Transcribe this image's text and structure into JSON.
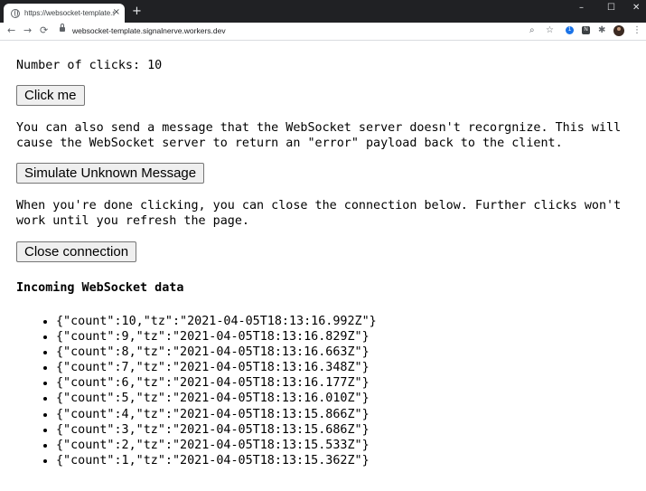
{
  "browser": {
    "tab_title": "https://websocket-template.signalnerve.workers.dev",
    "tab_close": "×",
    "new_tab": "+",
    "url": "websocket-template.signalnerve.workers.dev",
    "window_controls": {
      "minimize": "–",
      "maximize": "☐",
      "close": "✕"
    },
    "nav": {
      "back": "←",
      "forward": "→",
      "reload": "⟳"
    },
    "toolbar_icons": {
      "zoom": "⌕",
      "bookmark": "☆",
      "extensions": "✱",
      "menu": "⋮"
    },
    "extension_badges": [
      "1",
      "N"
    ]
  },
  "page": {
    "click_count_text": "Number of clicks: 10",
    "click_button": "Click me",
    "unknown_message_text_line1": "You can also send a message that the WebSocket server doesn't recorgnize. This will",
    "unknown_message_text_line2": "cause the WebSocket server to return an \"error\" payload back to the client.",
    "simulate_button": "Simulate Unknown Message",
    "close_text_line1": "When you're done clicking, you can close the connection below. Further clicks won't",
    "close_text_line2": "work until you refresh the page.",
    "close_button": "Close connection",
    "incoming_heading": "Incoming WebSocket data",
    "messages": [
      "{\"count\":10,\"tz\":\"2021-04-05T18:13:16.992Z\"}",
      "{\"count\":9,\"tz\":\"2021-04-05T18:13:16.829Z\"}",
      "{\"count\":8,\"tz\":\"2021-04-05T18:13:16.663Z\"}",
      "{\"count\":7,\"tz\":\"2021-04-05T18:13:16.348Z\"}",
      "{\"count\":6,\"tz\":\"2021-04-05T18:13:16.177Z\"}",
      "{\"count\":5,\"tz\":\"2021-04-05T18:13:16.010Z\"}",
      "{\"count\":4,\"tz\":\"2021-04-05T18:13:15.866Z\"}",
      "{\"count\":3,\"tz\":\"2021-04-05T18:13:15.686Z\"}",
      "{\"count\":2,\"tz\":\"2021-04-05T18:13:15.533Z\"}",
      "{\"count\":1,\"tz\":\"2021-04-05T18:13:15.362Z\"}"
    ]
  },
  "colors": {
    "titlebar": "#202124",
    "button_bg": "#efefef",
    "button_border": "#767676",
    "ext_badge_1": "#1a73e8",
    "ext_badge_2": "#3c4043"
  }
}
